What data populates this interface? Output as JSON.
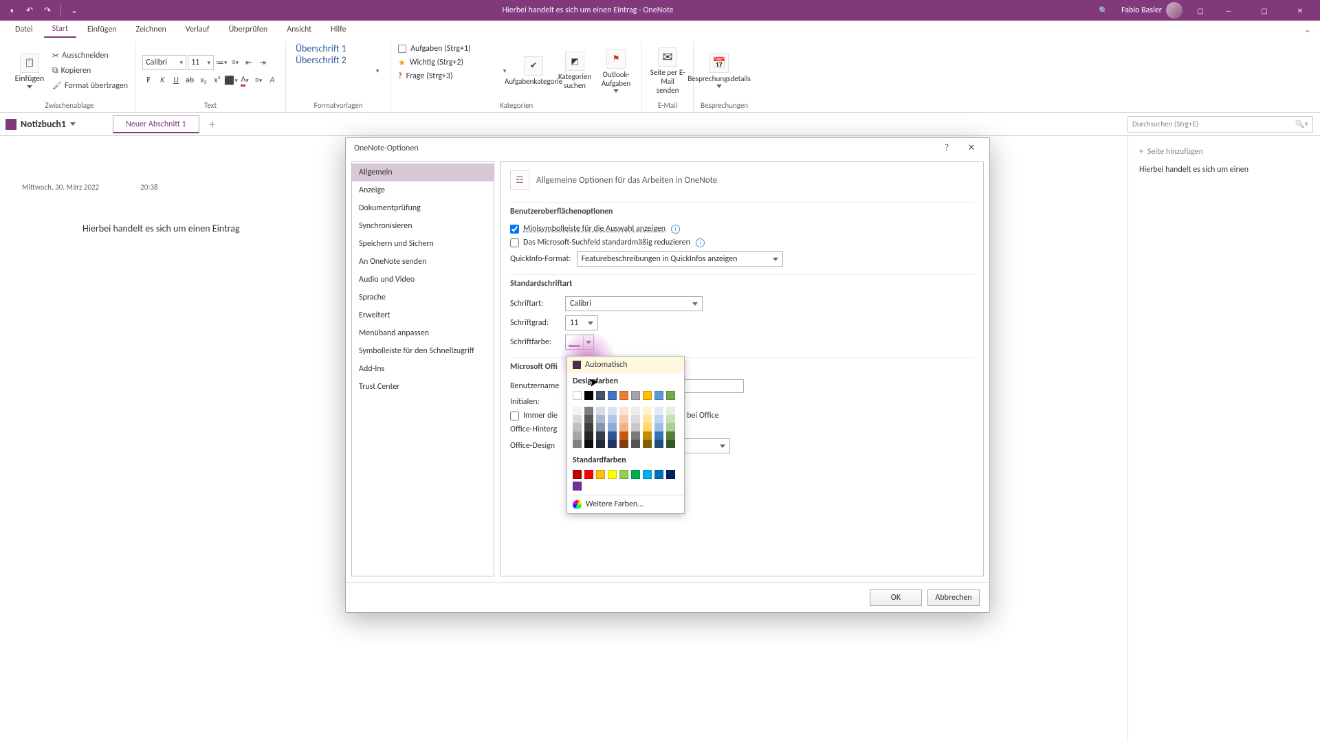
{
  "titlebar": {
    "title": "Hierbei handelt es sich um einen Eintrag  -  OneNote",
    "user": "Fabio Basler"
  },
  "menu": {
    "tabs": [
      "Datei",
      "Start",
      "Einfügen",
      "Zeichnen",
      "Verlauf",
      "Überprüfen",
      "Ansicht",
      "Hilfe"
    ],
    "active": 1
  },
  "ribbon": {
    "clipboard": {
      "paste": "Einfügen",
      "cut": "Ausschneiden",
      "copy": "Kopieren",
      "format": "Format übertragen",
      "group": "Zwischenablage"
    },
    "font": {
      "name": "Calibri",
      "size": "11",
      "group": "Text"
    },
    "styles": {
      "h1": "Überschrift 1",
      "h2": "Überschrift 2",
      "group": "Formatvorlagen"
    },
    "tags": {
      "t1": "Aufgaben (Strg+1)",
      "t2": "Wichtig (Strg+2)",
      "t3": "Frage (Strg+3)",
      "task": "Aufgabenkategorie",
      "find": "Kategorien suchen",
      "outlook": "Outlook-Aufgaben",
      "group": "Kategorien"
    },
    "email": {
      "btn": "Seite per E-Mail senden",
      "group": "E-Mail"
    },
    "meet": {
      "btn": "Besprechungsdetails",
      "group": "Besprechungen"
    }
  },
  "notebook": {
    "name": "Notizbuch1",
    "section": "Neuer Abschnitt 1",
    "search_ph": "Durchsuchen (Strg+E)"
  },
  "page": {
    "date": "Mittwoch, 30. März 2022",
    "time": "20:38",
    "note": "Hierbei handelt es sich um einen Eintrag"
  },
  "rpane": {
    "add": "Seite hinzufügen",
    "entry": "Hierbei handelt es sich um einen"
  },
  "dialog": {
    "title": "OneNote-Optionen",
    "nav": [
      "Allgemein",
      "Anzeige",
      "Dokumentprüfung",
      "Synchronisieren",
      "Speichern und Sichern",
      "An OneNote senden",
      "Audio und Video",
      "Sprache",
      "Erweitert",
      "Menüband anpassen",
      "Symbolleiste für den Schnellzugriff",
      "Add-Ins",
      "Trust Center"
    ],
    "nav_sel": 0,
    "heading": "Allgemeine Optionen für das Arbeiten in OneNote",
    "s1": "Benutzeroberflächenoptionen",
    "opt_mini": "Minisymbolleiste für die Auswahl anzeigen",
    "opt_search": "Das Microsoft-Suchfeld standardmäßig reduzieren",
    "quickinfo_lbl": "QuickInfo-Format:",
    "quickinfo_val": "Featurebeschreibungen in QuickInfos anzeigen",
    "s2": "Standardschriftart",
    "font_lbl": "Schriftart:",
    "font_val": "Calibri",
    "size_lbl": "Schriftgrad:",
    "size_val": "11",
    "color_lbl": "Schriftfarbe:",
    "s3": "Microsoft Offi",
    "uname_lbl": "Benutzername",
    "init_lbl": "Initialen:",
    "always_lbl": "Immer die",
    "bg_lbl": "Office-Hinterg",
    "design_lbl": "Office-Design",
    "design_tail": "g von der Anmeldung bei Office",
    "ok": "OK",
    "cancel": "Abbrechen"
  },
  "picker": {
    "auto": "Automatisch",
    "theme": "Designfarben",
    "std": "Standardfarben",
    "more": "Weitere Farben...",
    "theme_row": [
      "#ffffff",
      "#000000",
      "#44546a",
      "#4472c4",
      "#ed7d31",
      "#a5a5a5",
      "#ffc000",
      "#5b9bd5",
      "#70ad47"
    ],
    "theme_tints": [
      [
        "#f2f2f2",
        "#7f7f7f",
        "#d6dce5",
        "#d9e1f2",
        "#fce4d6",
        "#ededed",
        "#fff2cc",
        "#ddebf7",
        "#e2efda"
      ],
      [
        "#d9d9d9",
        "#595959",
        "#acb9ca",
        "#b4c6e7",
        "#f8cbad",
        "#dbdbdb",
        "#ffe699",
        "#bdd7ee",
        "#c6e0b4"
      ],
      [
        "#bfbfbf",
        "#404040",
        "#8497b0",
        "#8ea9db",
        "#f4b084",
        "#c9c9c9",
        "#ffd966",
        "#9bc2e6",
        "#a9d08e"
      ],
      [
        "#a6a6a6",
        "#262626",
        "#333f4f",
        "#305496",
        "#c65911",
        "#7b7b7b",
        "#bf8f00",
        "#2f75b5",
        "#548235"
      ],
      [
        "#808080",
        "#0d0d0d",
        "#222b35",
        "#203764",
        "#833c0c",
        "#525252",
        "#806000",
        "#1f4e78",
        "#375623"
      ]
    ],
    "std_row": [
      "#c00000",
      "#ff0000",
      "#ffc000",
      "#ffff00",
      "#92d050",
      "#00b050",
      "#00b0f0",
      "#0070c0",
      "#002060",
      "#7030a0"
    ]
  }
}
